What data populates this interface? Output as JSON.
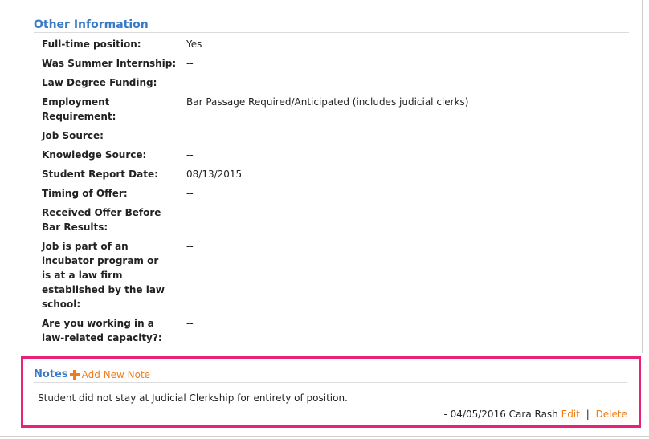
{
  "other_information": {
    "title": "Other Information",
    "rows": [
      {
        "label": "Full-time position:",
        "value": "Yes"
      },
      {
        "label": "Was Summer Internship:",
        "value": "--"
      },
      {
        "label": "Law Degree Funding:",
        "value": "--"
      },
      {
        "label": "Employment Requirement:",
        "value": "Bar Passage Required/Anticipated (includes judicial clerks)"
      },
      {
        "label": "Job Source:",
        "value": ""
      },
      {
        "label": "Knowledge Source:",
        "value": "--"
      },
      {
        "label": "Student Report Date:",
        "value": "08/13/2015"
      },
      {
        "label": "Timing of Offer:",
        "value": "--"
      },
      {
        "label": "Received Offer Before Bar Results:",
        "value": "--"
      },
      {
        "label": "Job is part of an incubator program or is at a law firm established by the law school:",
        "value": "--"
      },
      {
        "label": "Are you working in a law-related capacity?:",
        "value": "--"
      }
    ]
  },
  "notes": {
    "title": "Notes",
    "add_label": "Add New Note",
    "add_icon": "plus-icon",
    "items": [
      {
        "text": "Student did not stay at Judicial Clerkship for entirety of position.",
        "meta": "- 04/05/2016 Cara Rash",
        "edit_label": "Edit",
        "separator": "|",
        "delete_label": "Delete"
      }
    ]
  },
  "colors": {
    "heading_blue": "#3b7bc6",
    "link_orange": "#f07c19",
    "highlight_border": "#e8217a"
  }
}
